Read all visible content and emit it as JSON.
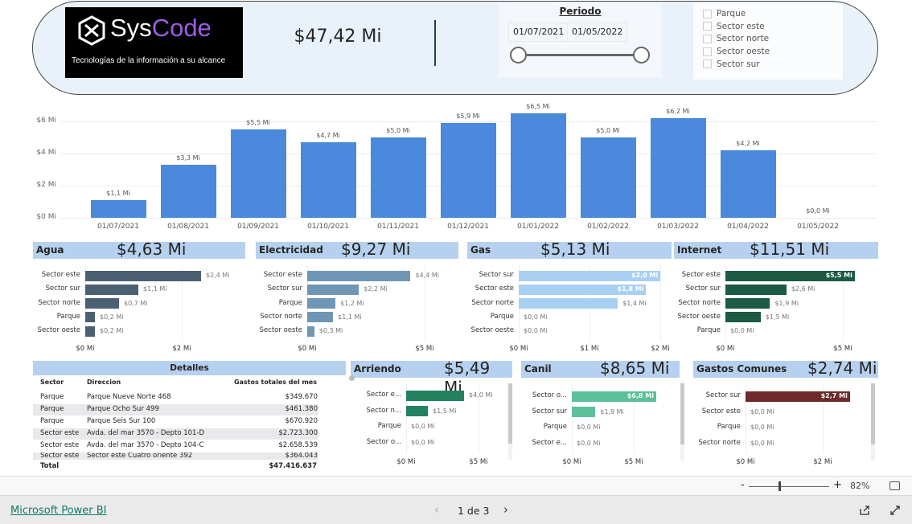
{
  "header": {
    "logo": {
      "name_a": "Sys",
      "name_b": "Code",
      "tagline": "Tecnologías de la información a su alcance"
    },
    "total": "$47,42 Mi",
    "period": {
      "title": "Periodo",
      "start": "01/07/2021",
      "end": "01/05/2022",
      "range_fraction": [
        0,
        1
      ]
    },
    "sector_slicer": [
      {
        "label": "Parque",
        "checked": false
      },
      {
        "label": "Sector este",
        "checked": false
      },
      {
        "label": "Sector norte",
        "checked": false
      },
      {
        "label": "Sector oeste",
        "checked": false
      },
      {
        "label": "Sector sur",
        "checked": false
      }
    ]
  },
  "chart_data": [
    {
      "type": "bar",
      "title": "",
      "categories": [
        "01/07/2021",
        "01/08/2021",
        "01/09/2021",
        "01/10/2021",
        "01/11/2021",
        "01/12/2021",
        "01/01/2022",
        "01/02/2022",
        "01/03/2022",
        "01/04/2022",
        "01/05/2022"
      ],
      "values": [
        1.1,
        3.3,
        5.5,
        4.7,
        5.0,
        5.9,
        6.5,
        5.0,
        6.2,
        4.2,
        0.0
      ],
      "data_labels": [
        "$1,1 Mi",
        "$3,3 Mi",
        "$5,5 Mi",
        "$4,7 Mi",
        "$5,0 Mi",
        "$5,9 Mi",
        "$6,5 Mi",
        "$5,0 Mi",
        "$6,2 Mi",
        "$4,2 Mi",
        "$0,0 Mi"
      ],
      "yticks": [
        {
          "v": 0,
          "label": "$0 Mi"
        },
        {
          "v": 2,
          "label": "$2 Mi"
        },
        {
          "v": 4,
          "label": "$4 Mi"
        },
        {
          "v": 6,
          "label": "$6 Mi"
        }
      ],
      "ylim": [
        0,
        6.5
      ],
      "grid": true,
      "color": "#4a89dc"
    },
    {
      "id": "agua",
      "type": "bar",
      "orientation": "horizontal",
      "title": "Agua",
      "total": "$4,63 Mi",
      "color": "#4c6074",
      "categories": [
        "Sector este",
        "Sector sur",
        "Sector norte",
        "Parque",
        "Sector oeste"
      ],
      "values": [
        2.4,
        1.1,
        0.7,
        0.2,
        0.2
      ],
      "data_labels": [
        "$2,4 Mi",
        "$1,1 Mi",
        "$0,7 Mi",
        "$0,2 Mi",
        "$0,2 Mi"
      ],
      "xticks": [
        {
          "v": 0,
          "label": "$0 Mi"
        },
        {
          "v": 2,
          "label": "$2 Mi"
        }
      ]
    },
    {
      "id": "electricidad",
      "type": "bar",
      "orientation": "horizontal",
      "title": "Electricidad",
      "total": "$9,27 Mi",
      "color": "#7096b5",
      "categories": [
        "Sector este",
        "Sector sur",
        "Parque",
        "Sector norte",
        "Sector oeste"
      ],
      "values": [
        4.4,
        2.2,
        1.2,
        1.1,
        0.3
      ],
      "data_labels": [
        "$4,4 Mi",
        "$2,2 Mi",
        "$1,2 Mi",
        "$1,1 Mi",
        "$0,3 Mi"
      ],
      "xticks": [
        {
          "v": 0,
          "label": "$0 Mi"
        },
        {
          "v": 5,
          "label": "$5 Mi"
        }
      ]
    },
    {
      "id": "gas",
      "type": "bar",
      "orientation": "horizontal",
      "title": "Gas",
      "total": "$5,13 Mi",
      "color": "#a8d0f2",
      "categories": [
        "Sector sur",
        "Sector este",
        "Sector norte",
        "Parque",
        "Sector oeste"
      ],
      "values": [
        2.0,
        1.8,
        1.4,
        0.0,
        0.0
      ],
      "data_labels": [
        "$2,0 Mi",
        "$1,8 Mi",
        "$1,4 Mi",
        "$0,0 Mi",
        "$0,0 Mi"
      ],
      "xticks": [
        {
          "v": 0,
          "label": "$0 Mi"
        },
        {
          "v": 1,
          "label": "$1 Mi"
        },
        {
          "v": 2,
          "label": "$2 Mi"
        }
      ]
    },
    {
      "id": "internet",
      "type": "bar",
      "orientation": "horizontal",
      "title": "Internet",
      "total": "$11,51 Mi",
      "color": "#1c5a43",
      "categories": [
        "Sector este",
        "Sector sur",
        "Sector norte",
        "Sector oeste",
        "Parque"
      ],
      "values": [
        5.5,
        2.6,
        1.9,
        1.5,
        0.0
      ],
      "data_labels": [
        "$5,5 Mi",
        "$2,6 Mi",
        "$1,9 Mi",
        "$1,5 Mi",
        "$0,0 Mi"
      ],
      "xticks": [
        {
          "v": 0,
          "label": "$0 Mi"
        },
        {
          "v": 5,
          "label": "$5 Mi"
        }
      ]
    },
    {
      "id": "arriendo",
      "type": "bar",
      "orientation": "horizontal",
      "title": "Arriendo",
      "total": "$5,49 Mi",
      "color": "#22825f",
      "categories": [
        "Sector e...",
        "Sector n...",
        "Parque",
        "Sector o..."
      ],
      "values": [
        4.0,
        1.5,
        0.0,
        0.0
      ],
      "data_labels": [
        "$4,0 Mi",
        "$1,5 Mi",
        "$0,0 Mi",
        "$0,0 Mi"
      ],
      "xticks": [
        {
          "v": 0,
          "label": "$0 Mi"
        },
        {
          "v": 5,
          "label": "$5 Mi"
        }
      ]
    },
    {
      "id": "canil",
      "type": "bar",
      "orientation": "horizontal",
      "title": "Canil",
      "total": "$8,65 Mi",
      "color": "#5cc09a",
      "categories": [
        "Sector o...",
        "Sector sur",
        "Parque",
        "Sector e..."
      ],
      "values": [
        6.8,
        1.9,
        0.0,
        0.0
      ],
      "data_labels": [
        "$6,8 Mi",
        "$1,9 Mi",
        "$0,0 Mi",
        "$0,0 Mi"
      ],
      "xticks": [
        {
          "v": 0,
          "label": "$0 Mi"
        },
        {
          "v": 5,
          "label": "$5 Mi"
        }
      ]
    },
    {
      "id": "gastos",
      "type": "bar",
      "orientation": "horizontal",
      "title": "Gastos Comunes",
      "total": "$2,74 Mi",
      "color": "#6e2b2b",
      "categories": [
        "Sector sur",
        "Sector este",
        "Parque",
        "Sector norte"
      ],
      "values": [
        2.7,
        0.0,
        0.0,
        0.0
      ],
      "data_labels": [
        "$2,7 Mi",
        "$0,0 Mi",
        "$0,0 Mi",
        "$0,0 Mi"
      ],
      "xticks": [
        {
          "v": 0,
          "label": "$0 Mi"
        },
        {
          "v": 2,
          "label": "$2 Mi"
        }
      ]
    }
  ],
  "details": {
    "title": "Detalles",
    "columns": [
      "Sector",
      "Direccion",
      "Gastos totales del mes"
    ],
    "rows": [
      [
        "Parque",
        "Parque Nueve Norte 468",
        "$349.670"
      ],
      [
        "Parque",
        "Parque Ocho Sur 499",
        "$461.380"
      ],
      [
        "Parque",
        "Parque Seis Sur 100",
        "$670.920"
      ],
      [
        "Sector este",
        "Avda. del mar 3570 - Depto 101-D",
        "$2.723.300"
      ],
      [
        "Sector este",
        "Avda. del mar 3570 - Depto 104-C",
        "$2.658.539"
      ],
      [
        "Sector este",
        "Sector este Cuatro oriente 392",
        "$364.043"
      ]
    ],
    "total_label": "Total",
    "total_value": "$47.416.637"
  },
  "zoom": {
    "minus": "-",
    "plus": "+",
    "level": "82%"
  },
  "footer": {
    "brand": "Microsoft Power BI",
    "page": "1 de 3",
    "prev": "‹",
    "next": "›"
  }
}
